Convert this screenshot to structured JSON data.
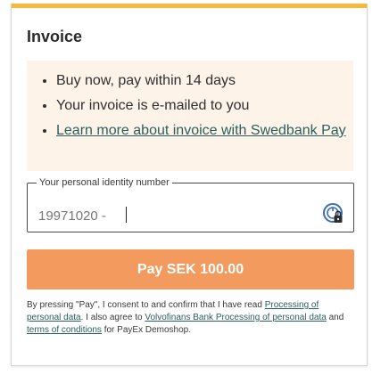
{
  "panel": {
    "title": "Invoice",
    "bullets": [
      "Buy now, pay within 14 days",
      "Your invoice is e-mailed to you"
    ],
    "learn_more_link": "Learn more about invoice with Swedbank Pay"
  },
  "pin_field": {
    "legend": "Your personal identity number",
    "value": "19971020 - ",
    "icon": "bankid-lock-icon"
  },
  "pay_button": {
    "label": "Pay SEK 100.00",
    "color": "#f39b5e"
  },
  "consent": {
    "part1": "By pressing \"Pay\", I consent to and confirm that I have read",
    "link1": "Processing of personal data",
    "part2": ". I also agree to",
    "link2": "Volvofinans Bank Processing of personal data",
    "part3": "and",
    "link3": "terms of conditions",
    "part4": "for PayEx Demoshop."
  },
  "colors": {
    "accent": "#f6b93b",
    "info_background": "#fdf3e8",
    "link": "#2a5f5f"
  }
}
